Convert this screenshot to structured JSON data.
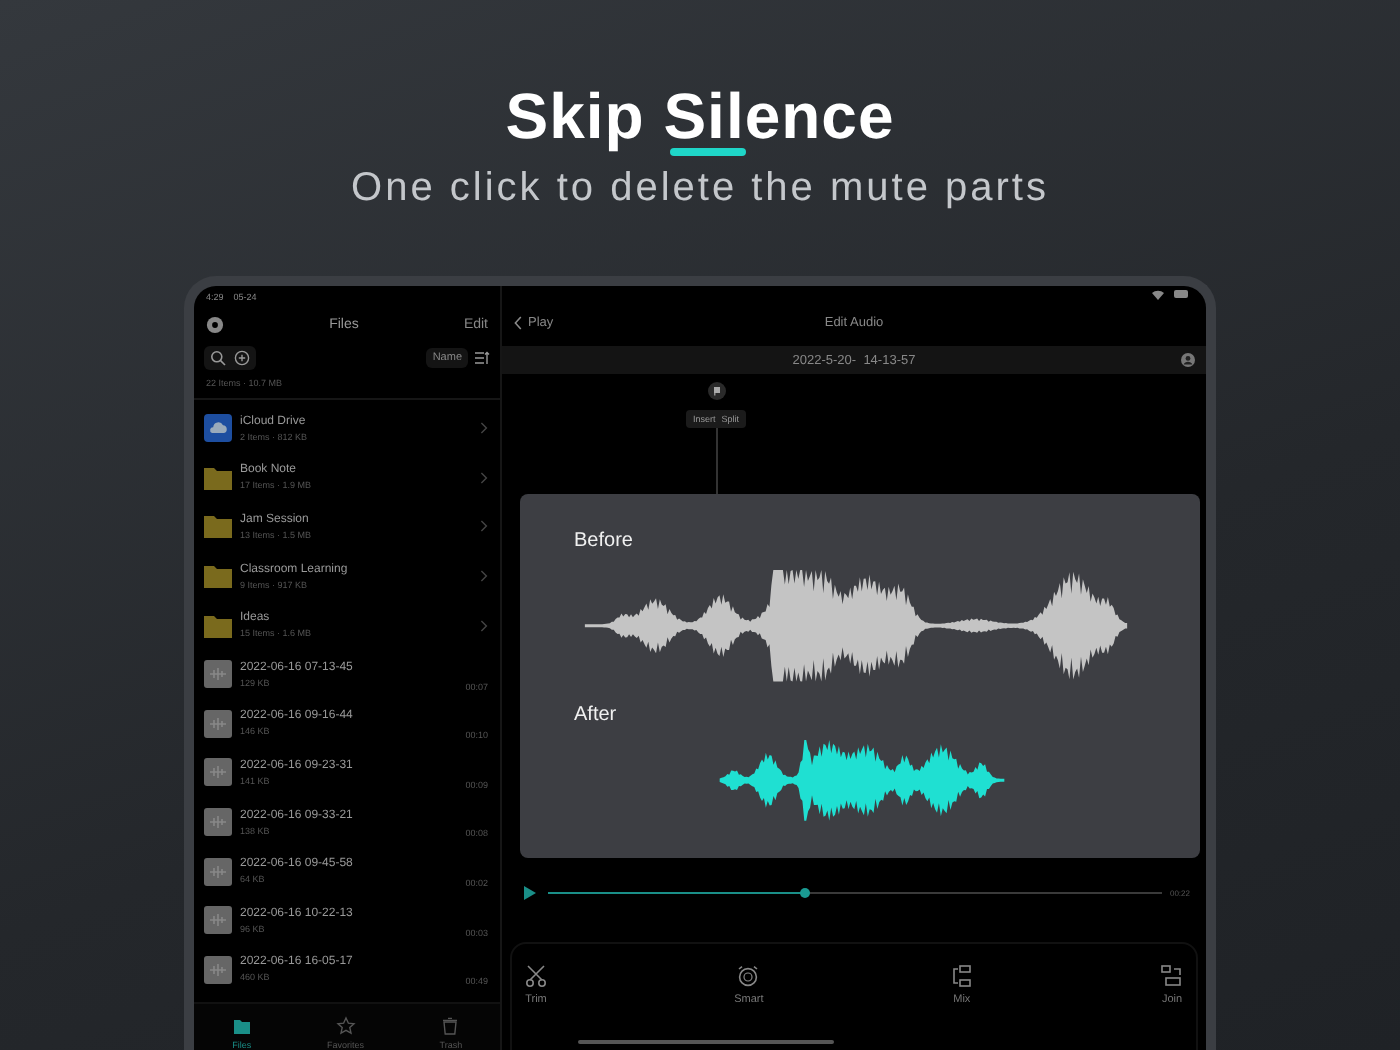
{
  "headline": {
    "title": "Skip Silence",
    "subtitle": "One click to delete the mute parts"
  },
  "status_bar": {
    "time": "4:29",
    "date": "05-24"
  },
  "sidebar": {
    "title": "Files",
    "edit": "Edit",
    "sort": "Name",
    "summary": "22 Items · 10.7 MB",
    "folders": [
      {
        "name": "iCloud Drive",
        "info": "2 Items · 812 KB",
        "kind": "cloud"
      },
      {
        "name": "Book Note",
        "info": "17 Items · 1.9 MB",
        "kind": "folder"
      },
      {
        "name": "Jam Session",
        "info": "13 Items · 1.5 MB",
        "kind": "folder"
      },
      {
        "name": "Classroom Learning",
        "info": "9 Items · 917 KB",
        "kind": "folder"
      },
      {
        "name": "Ideas",
        "info": "15 Items · 1.6 MB",
        "kind": "folder"
      }
    ],
    "recordings": [
      {
        "name": "2022-06-16 07-13-45",
        "size": "129 KB",
        "duration": "00:07"
      },
      {
        "name": "2022-06-16 09-16-44",
        "size": "146 KB",
        "duration": "00:10"
      },
      {
        "name": "2022-06-16 09-23-31",
        "size": "141 KB",
        "duration": "00:09"
      },
      {
        "name": "2022-06-16 09-33-21",
        "size": "138 KB",
        "duration": "00:08"
      },
      {
        "name": "2022-06-16 09-45-58",
        "size": "64 KB",
        "duration": "00:02"
      },
      {
        "name": "2022-06-16 10-22-13",
        "size": "96 KB",
        "duration": "00:03"
      },
      {
        "name": "2022-06-16 16-05-17",
        "size": "460 KB",
        "duration": "00:49"
      }
    ]
  },
  "tab_bar": [
    {
      "label": "Files",
      "selected": true,
      "kind": "folder"
    },
    {
      "label": "Favorites",
      "selected": false,
      "kind": "star"
    },
    {
      "label": "Trash",
      "selected": false,
      "kind": "trash"
    }
  ],
  "editor": {
    "back": "Play",
    "title": "Edit Audio",
    "file": "2022-5-20-  14-13-57",
    "marker_actions": [
      "Insert",
      "Split"
    ],
    "level": 0.42,
    "time": "00:22",
    "tools": [
      {
        "label": "Trim",
        "kind": "trim"
      },
      {
        "label": "Smart",
        "kind": "smart"
      },
      {
        "label": "Mix",
        "kind": "mix"
      },
      {
        "label": "Join",
        "kind": "join"
      }
    ]
  },
  "comparison": {
    "before_label": "Before",
    "after_label": "After"
  }
}
